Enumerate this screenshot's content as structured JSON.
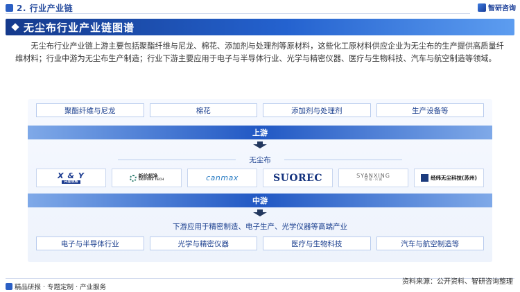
{
  "header": {
    "section": "2. 行业产业链",
    "brand": "智研咨询"
  },
  "banner": {
    "title": "无尘布行业产业链图谱"
  },
  "intro": "无尘布行业产业链上游主要包括聚酯纤维与尼龙、棉花、添加剂与处理剂等原材料，这些化工原材料供应企业为无尘布的生产提供高质量纤维材料；行业中游为无尘布生产制造；行业下游主要应用于电子与半导体行业、光学与精密仪器、医疗与生物科技、汽车与航空制造等领域。",
  "upstream": {
    "items": [
      "聚酯纤维与尼龙",
      "棉花",
      "添加剂与处理剂",
      "生产设备等"
    ],
    "label": "上游"
  },
  "midstream": {
    "title": "无尘布",
    "logos": [
      {
        "icon": "xy-logo",
        "text": "X & Y",
        "sub": "兴业卓辉"
      },
      {
        "icon": "skipure-logo",
        "text": "新纶超净",
        "sub": "SKIPURE TECH"
      },
      {
        "icon": "canmax-logo",
        "text": "canmax"
      },
      {
        "icon": "suorec-logo",
        "text": "SUOREC"
      },
      {
        "icon": "syanxing-logo",
        "text": "SYANXING",
        "sub": "善 裕 · 兴 翼"
      },
      {
        "icon": "jingwei-logo",
        "text": "经纬无尘科技(苏州)"
      }
    ],
    "label": "中游"
  },
  "downstream": {
    "title": "下游应用于精密制造、电子生产、光学仪器等高端产业",
    "items": [
      "电子与半导体行业",
      "光学与精密仪器",
      "医疗与生物科技",
      "汽车与航空制造等"
    ]
  },
  "footer": {
    "left": "精品研报 · 专题定制 · 产业服务",
    "right": "资料来源：公开资料、智研咨询整理"
  },
  "colors": {
    "primary": "#2462cf",
    "dark": "#153a8c",
    "accent": "#5d9df0"
  }
}
